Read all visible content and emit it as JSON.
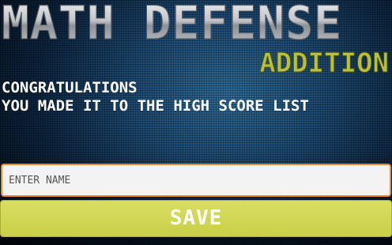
{
  "header": {
    "title": "MATH DEFENSE",
    "mode": "ADDITION"
  },
  "message": {
    "line1": "CONGRATULATIONS",
    "line2": "YOU MADE IT TO THE HIGH SCORE LIST"
  },
  "name_input": {
    "placeholder": "ENTER NAME",
    "value": ""
  },
  "save_button": {
    "label": "SAVE"
  },
  "colors": {
    "mode_text": "#b8c13a",
    "input_border": "#e8892a",
    "save_button_bg": "#d2d755",
    "message_text": "#ffffff"
  }
}
